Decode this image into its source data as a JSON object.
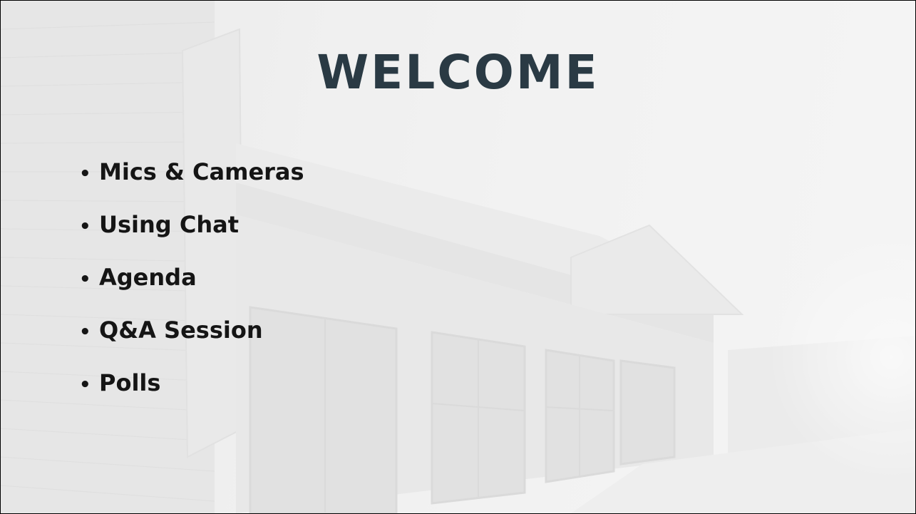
{
  "slide": {
    "title": "WELCOME",
    "bullet_symbol": "•",
    "items": [
      "Mics & Cameras",
      "Using Chat",
      "Agenda",
      "Q&A Session",
      "Polls"
    ]
  },
  "colors": {
    "title": "#2a3a44",
    "text": "#151515",
    "background": "#eeeeee"
  }
}
